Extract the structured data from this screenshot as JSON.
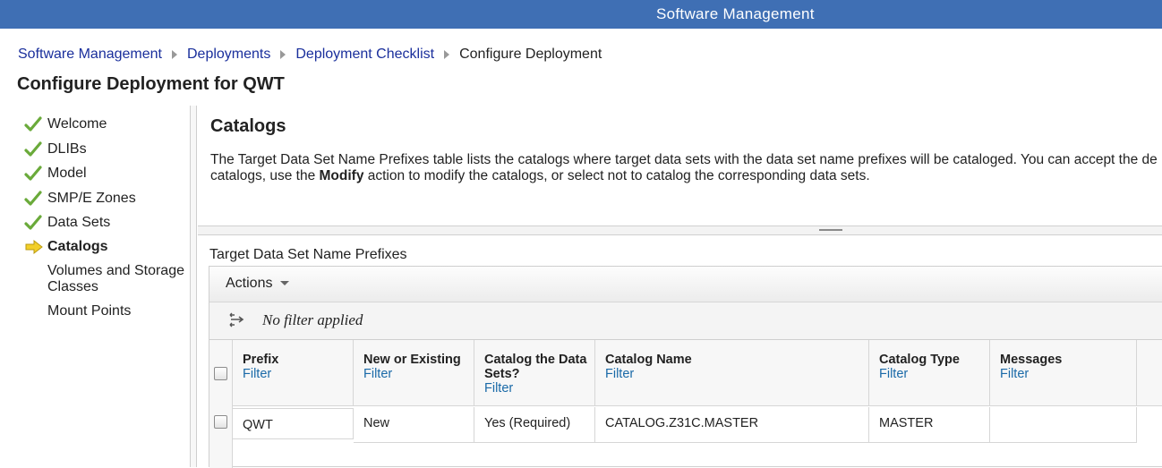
{
  "app": {
    "title": "Software Management"
  },
  "breadcrumb": [
    "Software Management",
    "Deployments",
    "Deployment Checklist"
  ],
  "breadcrumb_current": "Configure Deployment",
  "page_title": "Configure Deployment for QWT",
  "steps": [
    {
      "label": "Welcome",
      "status": "done"
    },
    {
      "label": "DLIBs",
      "status": "done"
    },
    {
      "label": "Model",
      "status": "done"
    },
    {
      "label": "SMP/E Zones",
      "status": "done"
    },
    {
      "label": "Data Sets",
      "status": "done"
    },
    {
      "label": "Catalogs",
      "status": "current"
    },
    {
      "label": "Volumes and Storage Classes",
      "status": "pending"
    },
    {
      "label": "Mount Points",
      "status": "pending"
    }
  ],
  "section": {
    "title": "Catalogs",
    "description_line1": "The Target Data Set Name Prefixes table lists the catalogs where target data sets with the data set name prefixes will be cataloged.  You can accept the de",
    "description_line2_pre": "catalogs, use the ",
    "description_line2_bold": "Modify",
    "description_line2_post": " action to modify the catalogs, or select not to catalog the corresponding data sets."
  },
  "table": {
    "caption": "Target Data Set Name Prefixes",
    "actions_label": "Actions",
    "filter_status": "No filter applied",
    "filter_link": "Filter",
    "columns": [
      "Prefix",
      "New or Existing",
      "Catalog the Data Sets?",
      "Catalog Name",
      "Catalog Type",
      "Messages"
    ],
    "rows": [
      [
        "QWT",
        "New",
        "Yes (Required)",
        "CATALOG.Z31C.MASTER",
        "MASTER",
        ""
      ]
    ]
  },
  "colors": {
    "topbar": "#3f6fb4",
    "link": "#1a2f9c",
    "filter_link": "#1a6aa8",
    "check": "#6aaa3a",
    "arrow": "#f2cf2a"
  }
}
